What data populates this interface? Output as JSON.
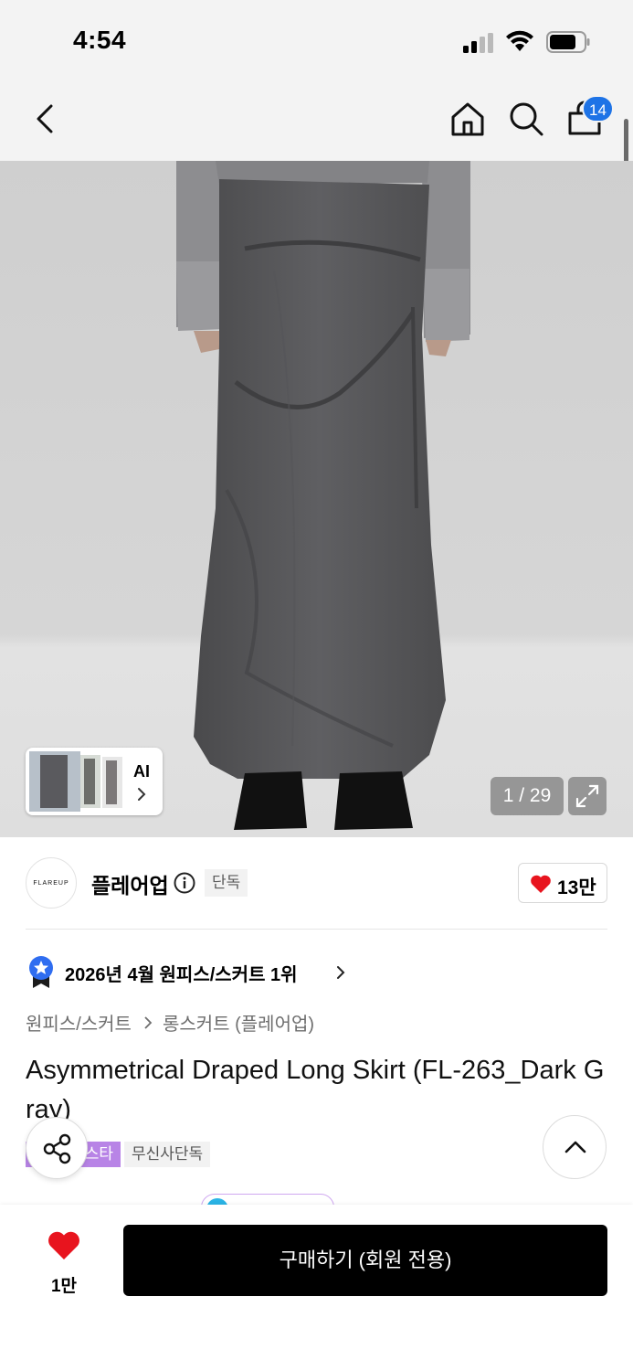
{
  "status_bar": {
    "time": "4:54"
  },
  "nav": {
    "cart_count": "14"
  },
  "gallery": {
    "ai_label": "AI",
    "counter": "1 / 29"
  },
  "brand": {
    "logo_text": "FLAREUP",
    "name": "플레어업",
    "exclusive_tag": "단독",
    "like_count": "13만"
  },
  "ranking": {
    "text": "2026년 4월 원피스/스커트 1위"
  },
  "breadcrumb": {
    "level1": "원피스/스커트",
    "level2": "롱스커트 (플레어업)"
  },
  "product": {
    "title": "Asymmetrical Draped Long Skirt (FL-263_Dark Gray)",
    "tags": [
      "스타",
      "무신사단독"
    ]
  },
  "bottom_bar": {
    "like_count": "1만",
    "buy_label": "구매하기 (회원 전용)"
  },
  "colors": {
    "accent_blue": "#1e73e6",
    "heart_red": "#e8141e",
    "tag_purple": "#b884e6",
    "background_gray": "#f3f3f3"
  },
  "icons": {
    "back": "chevron-left-icon",
    "home": "home-icon",
    "search": "search-icon",
    "cart": "shopping-bag-icon",
    "expand": "expand-icon",
    "info": "info-icon",
    "heart": "heart-icon",
    "medal": "medal-icon",
    "share": "share-icon",
    "scroll_top": "chevron-up-icon"
  }
}
